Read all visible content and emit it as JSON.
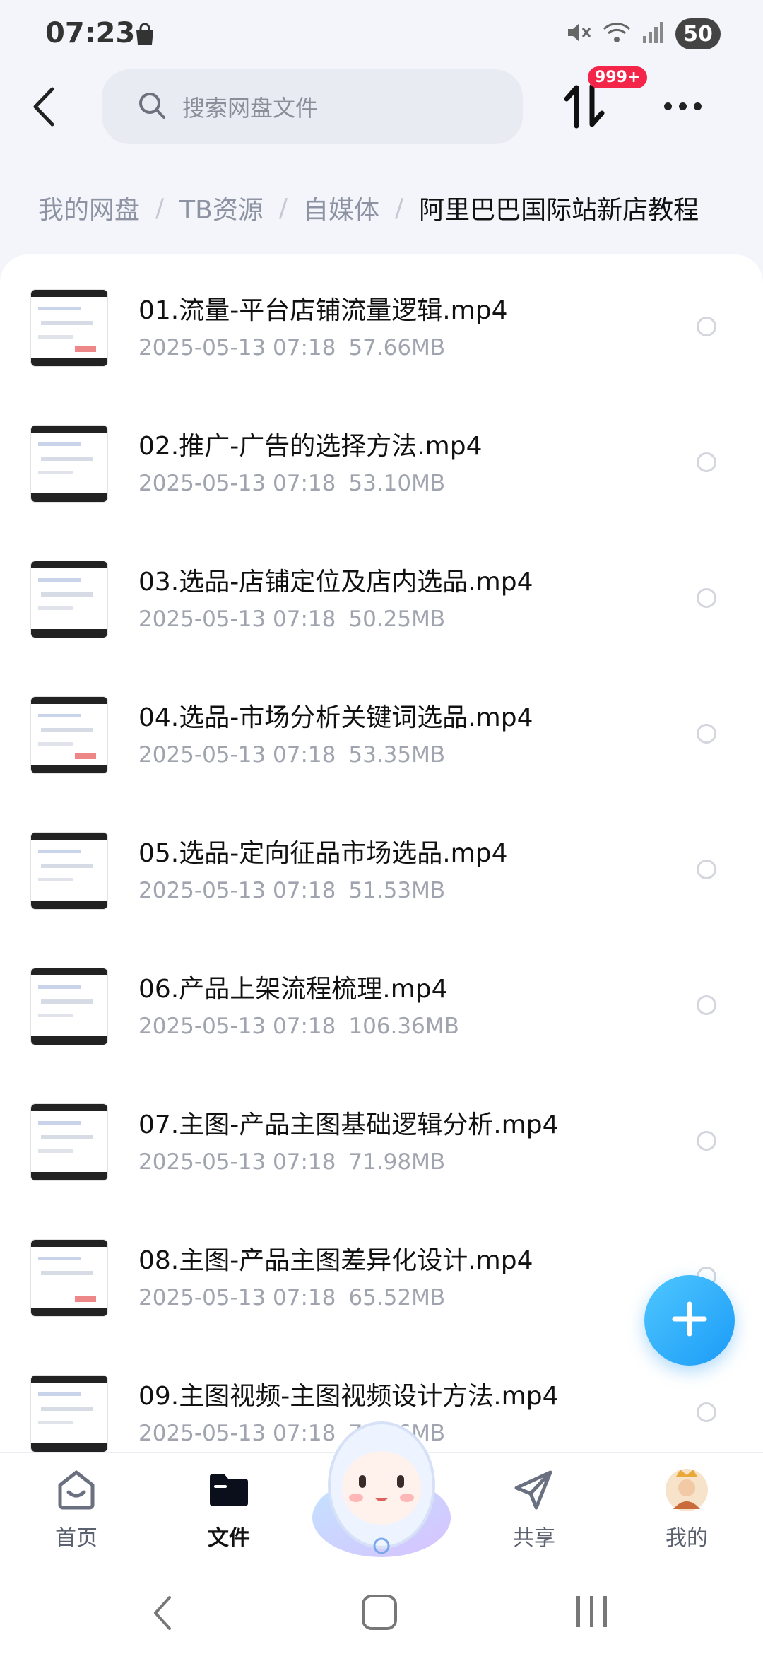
{
  "status_bar": {
    "time": "07:23",
    "battery": "50"
  },
  "header": {
    "search_placeholder": "搜索网盘文件",
    "transfer_badge": "999+"
  },
  "breadcrumb": [
    {
      "label": "我的网盘"
    },
    {
      "label": "TB资源"
    },
    {
      "label": "自媒体"
    },
    {
      "label": "阿里巴巴国际站新店教程"
    }
  ],
  "breadcrumb_sep": "/",
  "files": [
    {
      "name": "01.流量-平台店铺流量逻辑.mp4",
      "date": "2025-05-13",
      "time": "07:18",
      "size": "57.66MB"
    },
    {
      "name": "02.推广-广告的选择方法.mp4",
      "date": "2025-05-13",
      "time": "07:18",
      "size": "53.10MB"
    },
    {
      "name": "03.选品-店铺定位及店内选品.mp4",
      "date": "2025-05-13",
      "time": "07:18",
      "size": "50.25MB"
    },
    {
      "name": "04.选品-市场分析关键词选品.mp4",
      "date": "2025-05-13",
      "time": "07:18",
      "size": "53.35MB"
    },
    {
      "name": "05.选品-定向征品市场选品.mp4",
      "date": "2025-05-13",
      "time": "07:18",
      "size": "51.53MB"
    },
    {
      "name": "06.产品上架流程梳理.mp4",
      "date": "2025-05-13",
      "time": "07:18",
      "size": "106.36MB"
    },
    {
      "name": "07.主图-产品主图基础逻辑分析.mp4",
      "date": "2025-05-13",
      "time": "07:18",
      "size": "71.98MB"
    },
    {
      "name": "08.主图-产品主图差异化设计.mp4",
      "date": "2025-05-13",
      "time": "07:18",
      "size": "65.52MB"
    },
    {
      "name": "09.主图视频-主图视频设计方法.mp4",
      "date": "2025-05-13",
      "time": "07:18",
      "size": "78.16MB"
    }
  ],
  "bottom_nav": [
    {
      "label": "首页",
      "icon": "home-icon"
    },
    {
      "label": "文件",
      "icon": "folder-icon",
      "active": true
    },
    {
      "label": "共享",
      "icon": "share-icon"
    },
    {
      "label": "我的",
      "icon": "avatar"
    }
  ],
  "colors": {
    "accent": "#1b9bf7",
    "badge": "#f3264a"
  }
}
